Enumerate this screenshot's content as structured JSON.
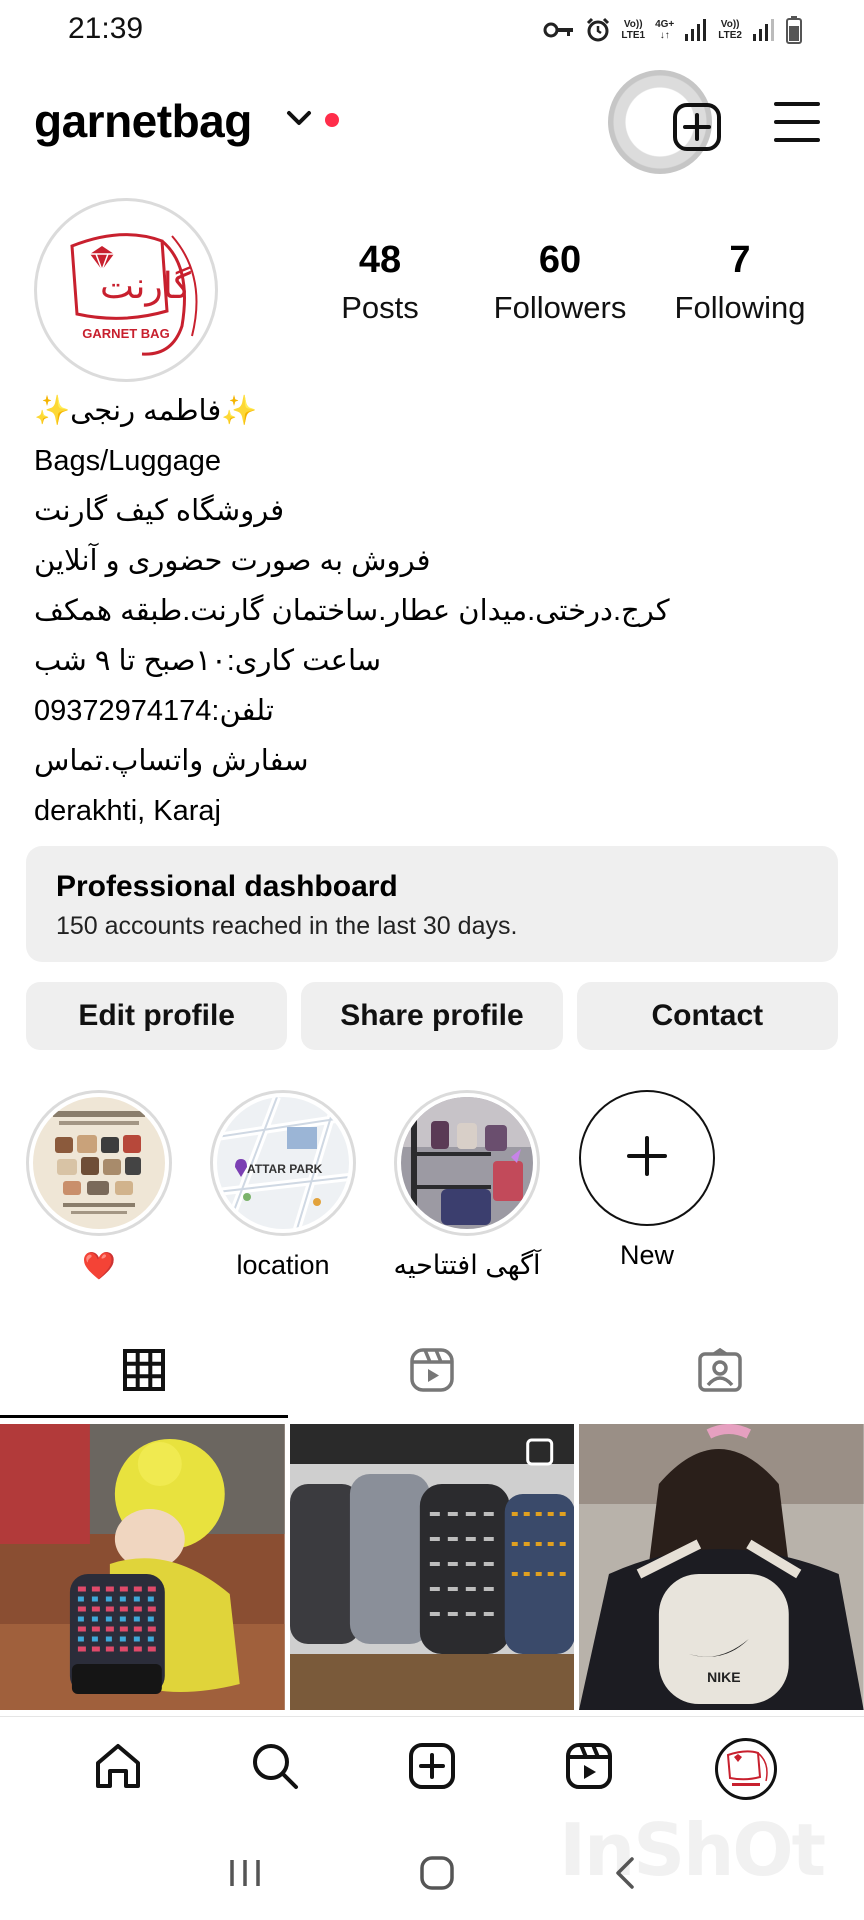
{
  "status_bar": {
    "time": "21:39",
    "net1_top": "Vo))",
    "net1_bottom": "LTE1",
    "net_4g": "4G+",
    "net2_top": "Vo))",
    "net2_bottom": "LTE2"
  },
  "header": {
    "username": "garnetbag"
  },
  "avatar": {
    "logo_text": "GARNET BAG",
    "logo_script": "گارنت"
  },
  "stats": [
    {
      "count": "48",
      "label": "Posts"
    },
    {
      "count": "60",
      "label": "Followers"
    },
    {
      "count": "7",
      "label": "Following"
    }
  ],
  "bio": {
    "name": "✨فاطمه رنجی✨",
    "category": "Bags/Luggage",
    "lines": [
      "فروشگاه کیف گارنت",
      "فروش به صورت حضوری و آنلاین",
      "کرج.درختی.میدان عطار.ساختمان گارنت.طبقه همکف",
      "ساعت کاری:۱۰صبح تا ۹ شب",
      "تلفن:09372974174",
      "سفارش واتساپ.تماس"
    ],
    "location": "derakhti, Karaj"
  },
  "dashboard": {
    "title": "Professional dashboard",
    "subtitle": "150 accounts reached in the last 30 days."
  },
  "actions": {
    "edit": "Edit profile",
    "share": "Share profile",
    "contact": "Contact"
  },
  "highlights": [
    {
      "label": "❤️"
    },
    {
      "label": "location",
      "map_text": "ATTAR PARK"
    },
    {
      "label": "آگهی افتتاحیه"
    },
    {
      "label": "New"
    }
  ],
  "grid": {
    "post2_brand": "",
    "post3_brand": "NIKE"
  },
  "watermark": "InShOt",
  "colors": {
    "accent_red": "#ff2d4a",
    "button_gray": "#efefef",
    "logo_red": "#c8202e"
  }
}
